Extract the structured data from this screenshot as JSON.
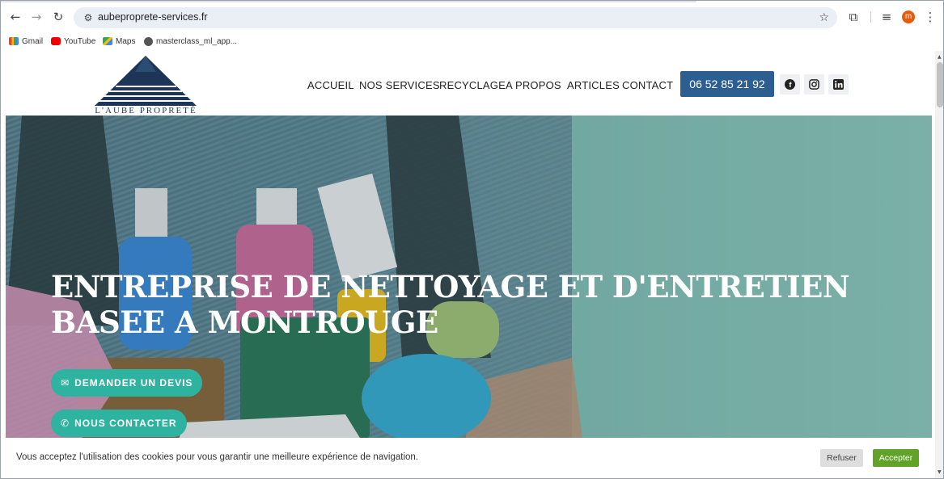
{
  "browser": {
    "url": "aubeproprete-services.fr",
    "avatar_letter": "m",
    "bookmarks": [
      {
        "label": "Gmail",
        "icon": "gmail-icon"
      },
      {
        "label": "YouTube",
        "icon": "youtube-icon"
      },
      {
        "label": "Maps",
        "icon": "maps-icon"
      },
      {
        "label": "masterclass_ml_app...",
        "icon": "globe-icon"
      }
    ]
  },
  "site": {
    "logo_text": "L'AUBE PROPRETÉ",
    "nav": {
      "accueil": "ACCUEIL",
      "services": "NOS SERVICES",
      "recyclage": "RECYCLAGE",
      "apropos": "A PROPOS",
      "articles": "ARTICLES",
      "contact": "CONTACT"
    },
    "phone": "06 52 85 21 92",
    "social": [
      "facebook-icon",
      "instagram-icon",
      "linkedin-icon"
    ]
  },
  "hero": {
    "title": "ENTREPRISE DE NETTOYAGE ET D'ENTRETIEN BASEE A MONTROUGE",
    "btn_devis": "DEMANDER UN DEVIS",
    "btn_contact": "NOUS CONTACTER"
  },
  "cookie": {
    "text": "Vous acceptez l'utilisation des cookies pour vous garantir une meilleure expérience de navigation.",
    "refuse": "Refuser",
    "accept": "Accepter"
  },
  "colors": {
    "brand_blue": "#2d5e92",
    "hero_teal": "#2fb3a1",
    "accept_green": "#61a229"
  }
}
